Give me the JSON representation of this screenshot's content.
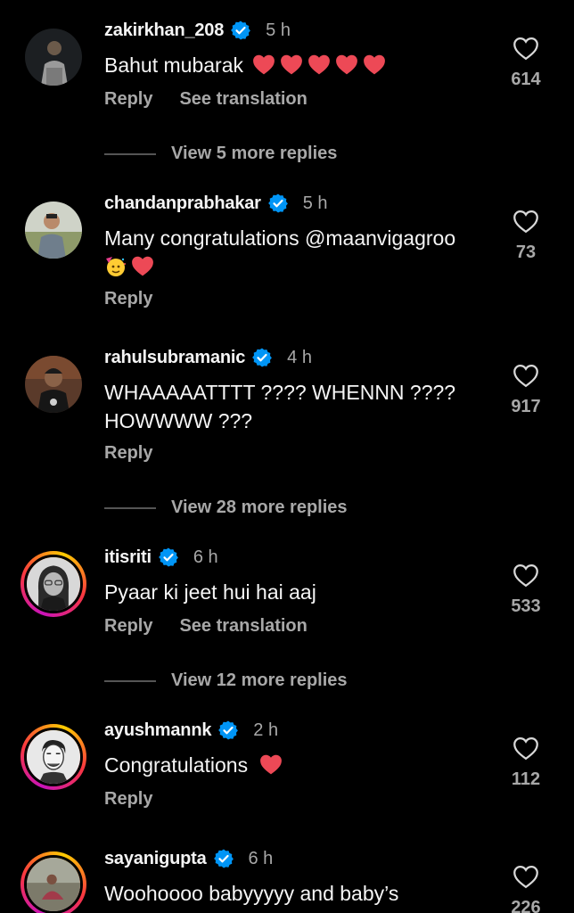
{
  "colors": {
    "background": "#000000",
    "primary_text": "#f5f5f5",
    "secondary_text": "#a8a8a8",
    "verified": "#0095f6",
    "heart": "#ed4956"
  },
  "comments": [
    {
      "username": "zakirkhan_208",
      "time": "5 h",
      "text": "Bahut mubarak",
      "reply_label": "Reply",
      "translate_label": "See translation",
      "likes": "614",
      "view_more": "View 5 more replies"
    },
    {
      "username": "chandanprabhakar",
      "time": "5 h",
      "text": "Many congratulations @maanvigagroo",
      "reply_label": "Reply",
      "likes": "73"
    },
    {
      "username": "rahulsubramanic",
      "time": "4 h",
      "text": "WHAAAAATTTT ???? WHENNN ????",
      "text_line2": "HOWWWW ???",
      "reply_label": "Reply",
      "likes": "917",
      "view_more": "View 28 more replies"
    },
    {
      "username": "itisriti",
      "time": "6 h",
      "text": "Pyaar ki jeet hui hai aaj",
      "reply_label": "Reply",
      "translate_label": "See translation",
      "likes": "533",
      "view_more": "View 12 more replies"
    },
    {
      "username": "ayushmannk",
      "time": "2 h",
      "text": "Congratulations",
      "reply_label": "Reply",
      "likes": "112"
    },
    {
      "username": "sayanigupta",
      "time": "6 h",
      "text": "Woohoooo babyyyyy and baby’s",
      "likes": "226"
    }
  ]
}
